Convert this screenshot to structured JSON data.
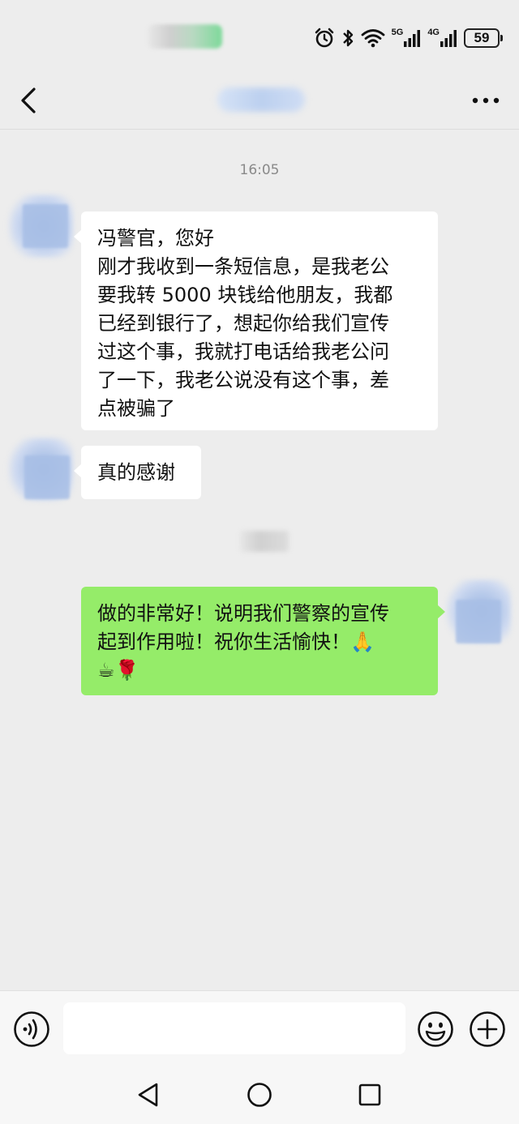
{
  "status_bar": {
    "network_1": "5G",
    "network_2": "4G",
    "battery_level": "59",
    "icons": [
      "alarm-icon",
      "bluetooth-icon",
      "wifi-icon",
      "signal-5g-icon",
      "signal-4g-icon",
      "battery-icon"
    ]
  },
  "header": {
    "icons": [
      "back-arrow-icon",
      "more-dots-icon"
    ]
  },
  "chat": {
    "timestamp": "16:05",
    "messages": [
      {
        "direction": "incoming",
        "lines": [
          "冯警官，您好",
          "刚才我收到一条短信息，是我老公",
          "要我转 5000 块钱给他朋友，我都",
          "已经到银行了，想起你给我们宣传",
          "过这个事，我就打电话给我老公问",
          "了一下，我老公说没有这个事，差",
          "点被骗了"
        ]
      },
      {
        "direction": "incoming",
        "lines": [
          "真的感谢"
        ]
      },
      {
        "direction": "outgoing",
        "lines": [
          "做的非常好！说明我们警察的宣传",
          "起到作用啦！祝你生活愉快！🙏",
          "☕🌹"
        ]
      }
    ]
  },
  "input_bar": {
    "placeholder": "",
    "icons": [
      "voice-icon",
      "emoji-icon",
      "plus-icon"
    ]
  },
  "nav_bar": {
    "icons": [
      "nav-back-icon",
      "nav-home-icon",
      "nav-recent-icon"
    ]
  },
  "colors": {
    "background": "#ededed",
    "incoming_bubble": "#ffffff",
    "outgoing_bubble": "#95ec69",
    "timestamp_text": "#8a8a8a"
  }
}
